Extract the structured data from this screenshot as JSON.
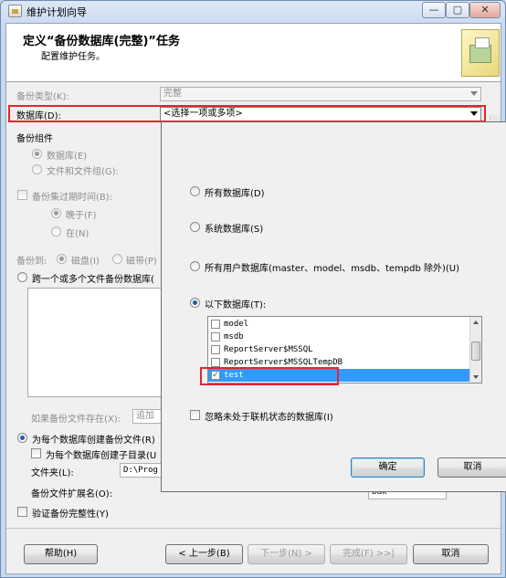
{
  "window": {
    "title": "维护计划向导",
    "caption_buttons": {
      "minimize": "—",
      "maximize": "▢",
      "close": "✕"
    }
  },
  "header": {
    "title": "定义“备份数据库(完整)”任务",
    "subtitle": "配置维护任务。"
  },
  "form": {
    "backup_type_label": "备份类型(K):",
    "backup_type_value": "完整",
    "databases_label": "数据库(D):",
    "databases_value": "<选择一项或多项>",
    "backup_component_label": "备份组件",
    "component_database": "数据库(E)",
    "component_files": "文件和文件组(G):",
    "backup_set_expires": "备份集过期时间(B):",
    "expires_after": "晚于(F)",
    "expires_on": "在(N)",
    "backup_to_label": "备份到:",
    "backup_to_disk": "磁盘(I)",
    "backup_to_tape": "磁带(P)",
    "across_files": "跨一个或多个文件备份数据库(",
    "if_file_exists": "如果备份文件存在(X):",
    "if_file_exists_value": "追加",
    "create_per_db": "为每个数据库创建备份文件(R)",
    "create_subdir": "为每个数据库创建子目录(U",
    "folder_label": "文件夹(L):",
    "folder_value": "D:\\Prog",
    "extension_label": "备份文件扩展名(O):",
    "extension_value": "bak",
    "verify": "验证备份完整性(Y)"
  },
  "popup": {
    "all_databases": "所有数据库(D)",
    "system_databases": "系统数据库(S)",
    "user_databases": "所有用户数据库(master、model、msdb、tempdb 除外)(U)",
    "these_databases": "以下数据库(T):",
    "db_list": [
      {
        "name": "model",
        "checked": false,
        "selected": false
      },
      {
        "name": "msdb",
        "checked": false,
        "selected": false
      },
      {
        "name": "ReportServer$MSSQL",
        "checked": false,
        "selected": false
      },
      {
        "name": "ReportServer$MSSQLTempDB",
        "checked": false,
        "selected": false
      },
      {
        "name": "test",
        "checked": true,
        "selected": true
      }
    ],
    "ignore_offline": "忽略未处于联机状态的数据库(I)",
    "ok": "确定",
    "cancel": "取消"
  },
  "footer": {
    "help": "帮助(H)",
    "back": "< 上一步(B)",
    "next": "下一步(N) >",
    "finish": "完成(F) >>|",
    "cancel": "取消"
  },
  "colors": {
    "highlight": "#e3262c",
    "selection": "#3399ff"
  }
}
